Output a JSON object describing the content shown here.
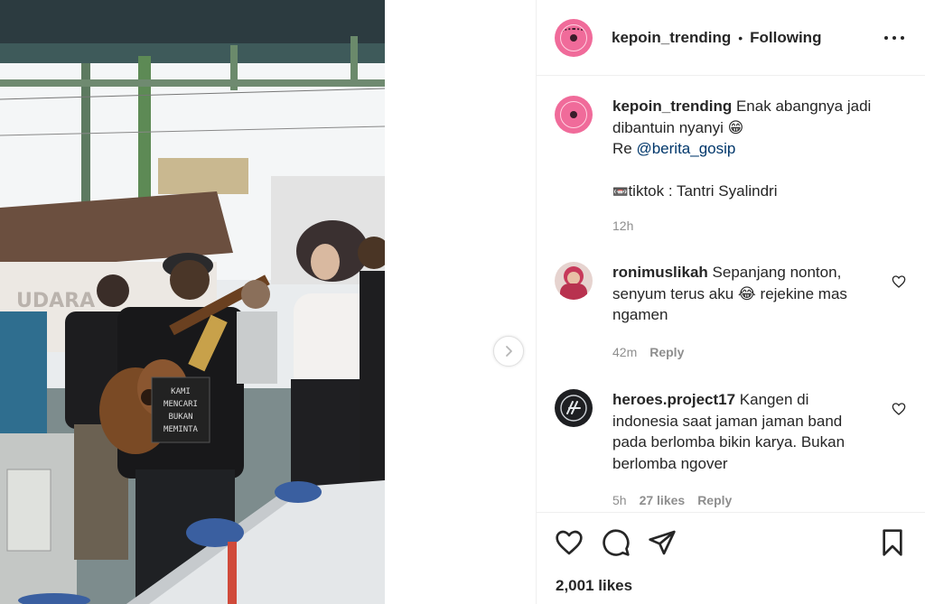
{
  "post": {
    "author": "kepoin_trending",
    "separator": "•",
    "follow_state": "Following",
    "caption": {
      "text_line1": "Enak abangnya jadi",
      "text_line2": "dibantuin nyanyi",
      "emoji": "😁",
      "repost_prefix": "Re",
      "repost_handle": "@berita_gosip",
      "source_icon": "📼",
      "source_text": "tiktok : Tantri Syalindri",
      "time": "12h"
    },
    "likes": "2,001 likes"
  },
  "video_text": {
    "shirt_line1": "KAMI",
    "shirt_line2": "MENCARI",
    "shirt_line3": "BUKAN",
    "shirt_line4": "MEMINTA",
    "sign": "UDARA"
  },
  "comments": [
    {
      "user": "ronimuslikah",
      "text_a": "Sepanjang nonton,",
      "text_b": "senyum terus aku",
      "emoji": "😂",
      "text_c": "rejekine mas",
      "text_d": "ngamen",
      "time": "42m",
      "reply": "Reply"
    },
    {
      "user": "heroes.project17",
      "text_a": "Kangen di",
      "text_b": "indonesia saat jaman jaman band",
      "text_c": "pada berlomba bikin karya. Bukan",
      "text_d": "berlomba ngover",
      "time": "5h",
      "likes": "27 likes",
      "reply": "Reply"
    }
  ],
  "icons": {
    "more": "more-horizontal-icon",
    "next": "chevron-right-icon",
    "like": "heart-icon",
    "comment": "comment-icon",
    "share": "send-icon",
    "save": "bookmark-icon"
  },
  "colors": {
    "avatar_pink": "#f06b9a",
    "link": "#00376b",
    "muted": "#8e8e8e"
  }
}
